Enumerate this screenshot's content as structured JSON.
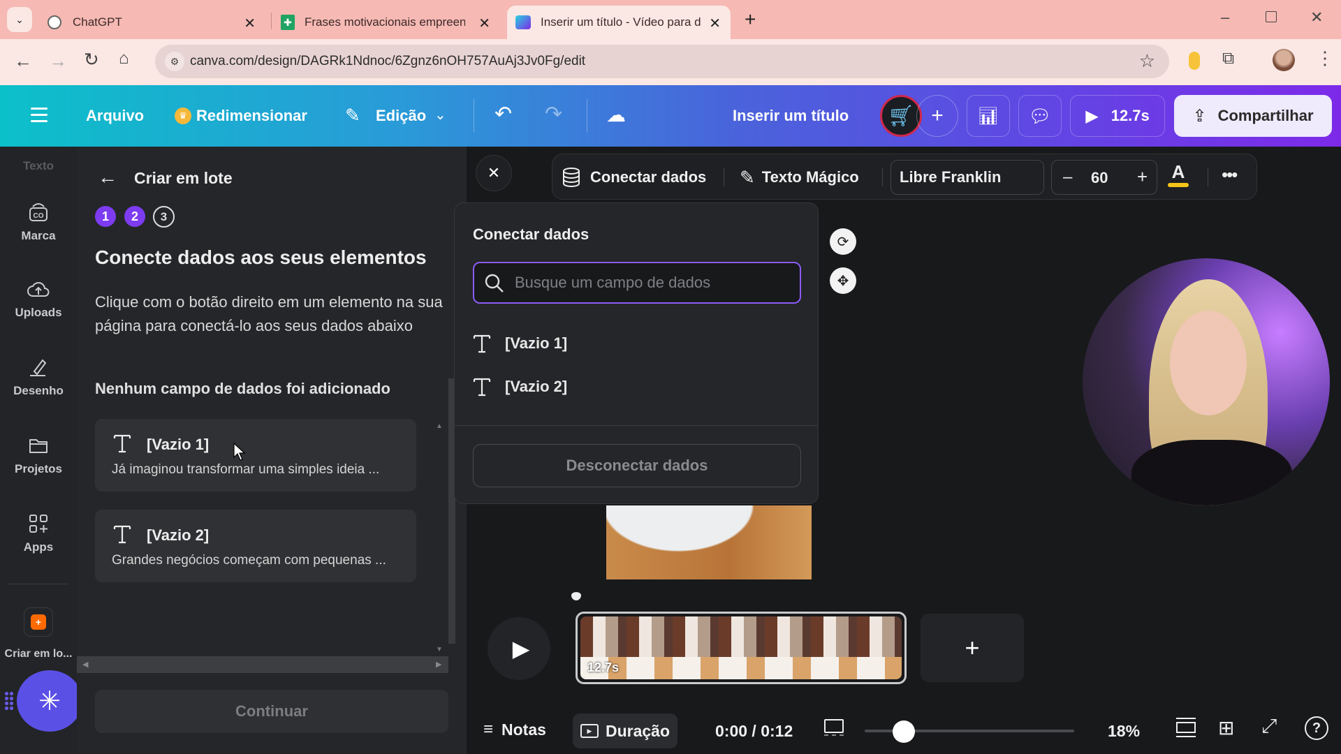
{
  "browser": {
    "tabs": [
      {
        "title": "ChatGPT",
        "icon": "chatgpt-icon",
        "active": false
      },
      {
        "title": "Frases motivacionais empreend",
        "icon": "google-sheets-icon",
        "active": false
      },
      {
        "title": "Inserir um título - Vídeo para d",
        "icon": "canva-video-icon",
        "active": true
      }
    ],
    "url": "canva.com/design/DAGRk1Ndnoc/6Zgnz6nOH757AuAj3Jv0Fg/edit"
  },
  "header": {
    "menu_icon": "hamburger-icon",
    "file": "Arquivo",
    "resize": "Redimensionar",
    "edit_mode": "Edição",
    "title": "Inserir um título",
    "play_duration": "12.7s",
    "share": "Compartilhar"
  },
  "rail": {
    "top_faded": "Texto",
    "items": [
      {
        "label": "Marca",
        "icon": "brand-icon"
      },
      {
        "label": "Uploads",
        "icon": "cloud-upload-icon"
      },
      {
        "label": "Desenho",
        "icon": "draw-icon"
      },
      {
        "label": "Projetos",
        "icon": "folder-icon"
      },
      {
        "label": "Apps",
        "icon": "apps-icon"
      },
      {
        "label": "Criar em lo...",
        "icon": "bulk-create-icon"
      }
    ]
  },
  "panel": {
    "back_title": "Criar em lote",
    "steps": [
      "1",
      "2",
      "3"
    ],
    "current_step": 2,
    "heading": "Conecte dados aos seus elementos",
    "description": "Clique com o botão direito em um elemento na sua página para conectá-lo aos seus dados abaixo",
    "empty_notice": "Nenhum campo de dados foi adicionado",
    "cards": [
      {
        "title": "[Vazio 1]",
        "preview": "Já imaginou transformar uma simples ideia ..."
      },
      {
        "title": "[Vazio 2]",
        "preview": "Grandes negócios começam com pequenas ..."
      }
    ],
    "continue": "Continuar"
  },
  "context_toolbar": {
    "connect_data": "Conectar dados",
    "magic_text": "Texto Mágico",
    "font": "Libre Franklin",
    "font_size": "60",
    "text_color": "#f5c518"
  },
  "popover": {
    "title": "Conectar dados",
    "search_placeholder": "Busque um campo de dados",
    "search_value": "",
    "fields": [
      "[Vazio 1]",
      "[Vazio 2]"
    ],
    "disconnect": "Desconectar dados"
  },
  "timeline": {
    "clip_duration": "12.7s",
    "time": "0:00 / 0:12",
    "zoom": "18%",
    "zoom_fraction": 0.18,
    "notes": "Notas",
    "duration": "Duração"
  }
}
